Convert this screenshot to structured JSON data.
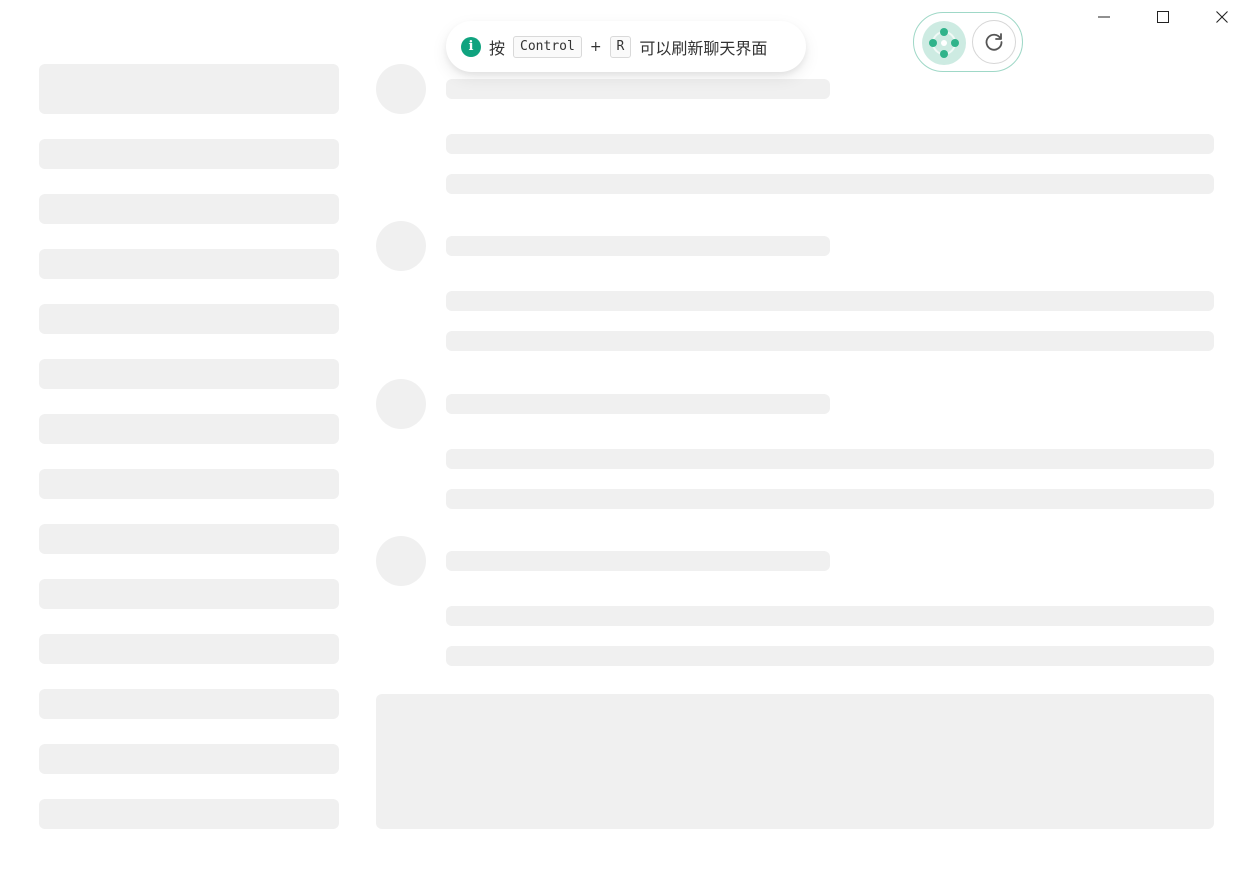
{
  "toast": {
    "prefix": "按",
    "key1": "Control",
    "plus": "+",
    "key2": "R",
    "suffix": "可以刷新聊天界面"
  },
  "icons": {
    "info": "info-icon",
    "logo": "app-logo-icon",
    "refresh": "refresh-icon",
    "minimize": "minimize-icon",
    "maximize": "maximize-icon",
    "close": "close-icon"
  },
  "colors": {
    "accent": "#10a37f",
    "skeleton": "#f0f0f0",
    "widget_border": "#9fd8c7"
  }
}
